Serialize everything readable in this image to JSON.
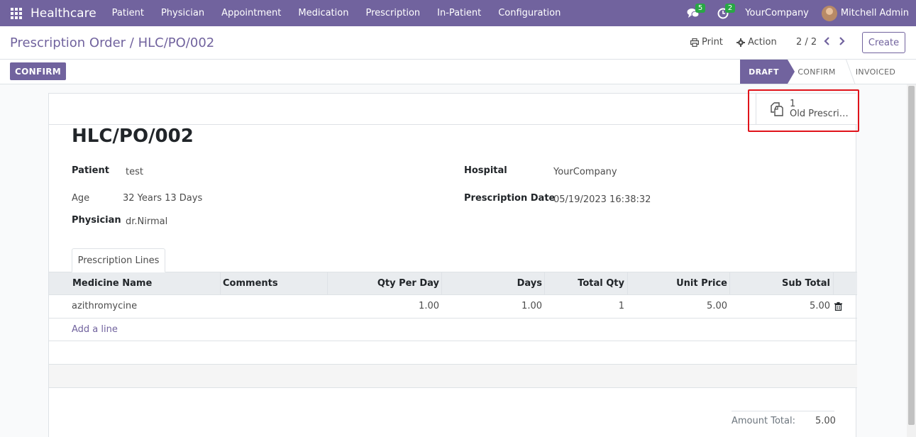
{
  "navbar": {
    "brand": "Healthcare",
    "menu": [
      "Patient",
      "Physician",
      "Appointment",
      "Medication",
      "Prescription",
      "In-Patient",
      "Configuration"
    ],
    "messages_count": "5",
    "activities_count": "2",
    "company": "YourCompany",
    "user": "Mitchell Admin",
    "accent_color": "#71639e"
  },
  "control": {
    "breadcrumb": "Prescription Order / HLC/PO/002",
    "print_label": "Print",
    "action_label": "Action",
    "pager": "2 / 2",
    "create_label": "Create"
  },
  "statusbar": {
    "confirm_button": "CONFIRM",
    "stages": [
      "DRAFT",
      "CONFIRM",
      "INVOICED"
    ],
    "active_stage": "DRAFT"
  },
  "smart_button": {
    "count": "1",
    "label": "Old Prescri…"
  },
  "form": {
    "title": "HLC/PO/002",
    "patient_label": "Patient",
    "patient_value": "test",
    "age_label": "Age",
    "age_value": "32 Years 13 Days",
    "physician_label": "Physician",
    "physician_value": "dr.Nirmal",
    "hospital_label": "Hospital",
    "hospital_value": "YourCompany",
    "date_label": "Prescription Date",
    "date_value": "05/19/2023 16:38:32"
  },
  "tab": {
    "label": "Prescription Lines"
  },
  "table": {
    "columns": [
      "Medicine Name",
      "Comments",
      "Qty Per Day",
      "Days",
      "Total Qty",
      "Unit Price",
      "Sub Total"
    ],
    "rows": [
      {
        "medicine": "azithromycine",
        "comments": "",
        "qty_per_day": "1.00",
        "days": "1.00",
        "total_qty": "1",
        "unit_price": "5.00",
        "sub_total": "5.00"
      }
    ],
    "add_line": "Add a line"
  },
  "totals": {
    "label": "Amount Total:",
    "value": "5.00"
  }
}
